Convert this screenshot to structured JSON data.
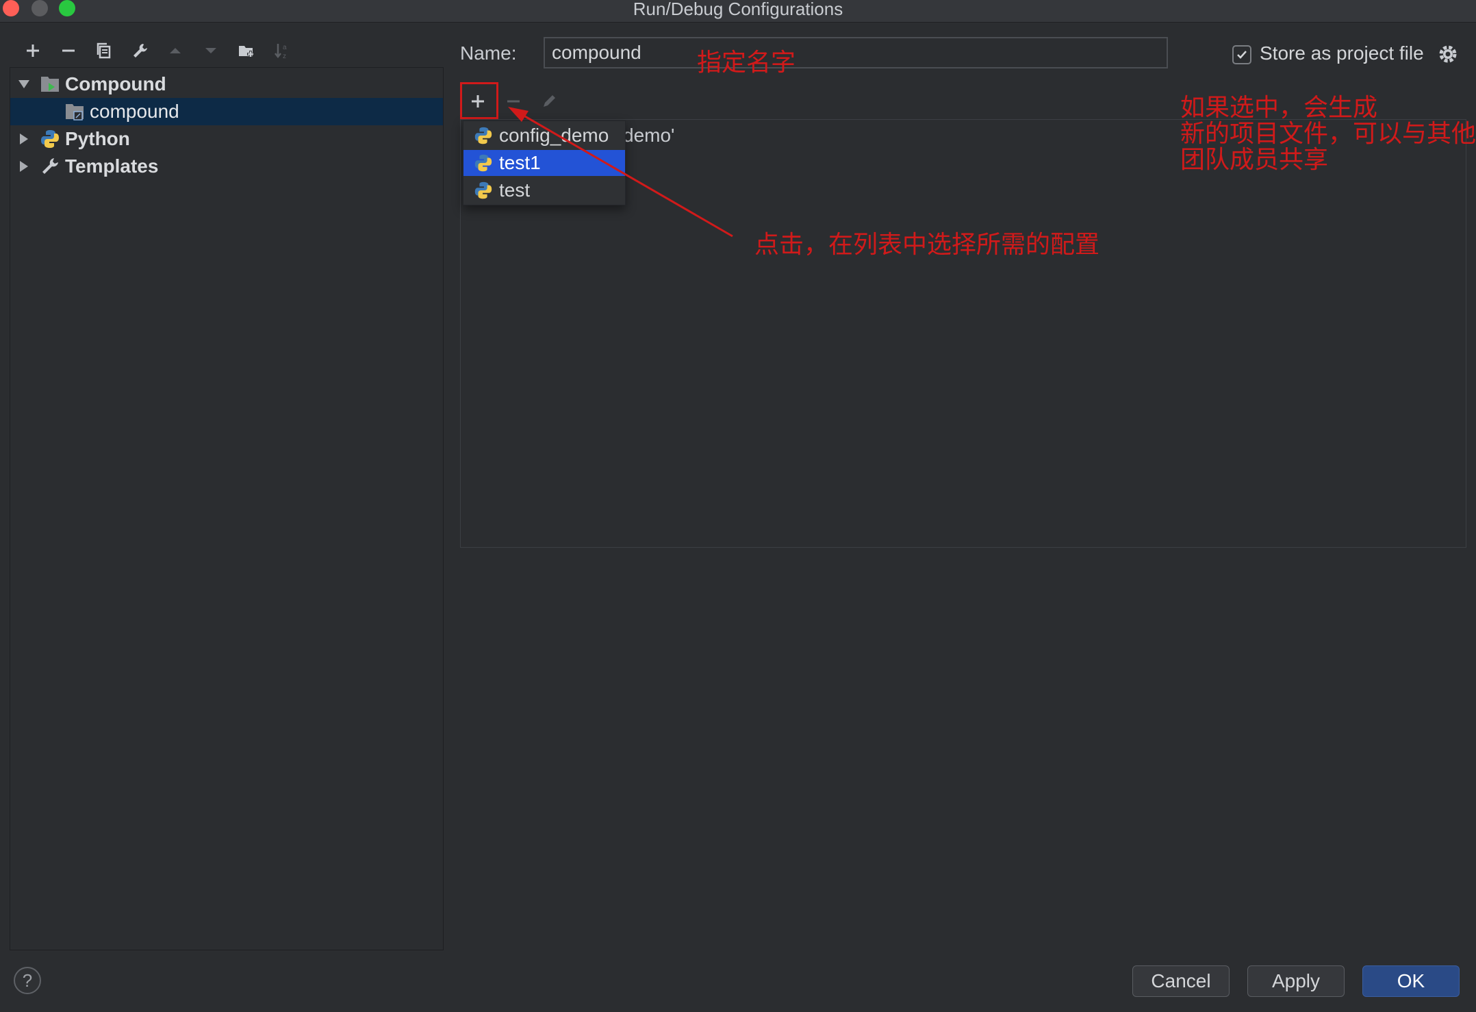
{
  "window": {
    "title": "Run/Debug Configurations"
  },
  "toolbar": {
    "icons": [
      "add-icon",
      "remove-icon",
      "copy-icon",
      "wrench-icon",
      "move-up-icon",
      "move-down-icon",
      "new-folder-icon",
      "sort-alpha-icon"
    ]
  },
  "tree": {
    "items": [
      {
        "label": "Compound",
        "icon": "compound-icon",
        "expanded": true
      },
      {
        "label": "compound",
        "icon": "compound-config-icon",
        "selected": true
      },
      {
        "label": "Python",
        "icon": "python-icon",
        "expanded": false
      },
      {
        "label": "Templates",
        "icon": "wrench-icon",
        "expanded": false
      }
    ]
  },
  "config": {
    "name_label": "Name:",
    "name_value": "compound",
    "store_checked": true,
    "store_label": "Store as project file",
    "list_behind_text": "demo'"
  },
  "popup": {
    "items": [
      {
        "label": "config_demo",
        "icon": "python-icon",
        "selected": false
      },
      {
        "label": "test1",
        "icon": "python-icon",
        "selected": true
      },
      {
        "label": "test",
        "icon": "python-icon",
        "selected": false
      }
    ]
  },
  "annotations": {
    "name_hint": "指定名字",
    "store_hint_line1": "如果选中，会生成",
    "store_hint_line2": "新的项目文件，可以与其他",
    "store_hint_line3": "团队成员共享",
    "add_hint": "点击，在列表中选择所需的配置",
    "color": "#d11a1a"
  },
  "footer": {
    "help_label": "?",
    "cancel_label": "Cancel",
    "apply_label": "Apply",
    "ok_label": "OK"
  },
  "colors": {
    "background": "#2b2d30",
    "selection_tree": "#0d2a46",
    "selection_popup": "#2353d6",
    "ok_button": "#2a4a86"
  }
}
